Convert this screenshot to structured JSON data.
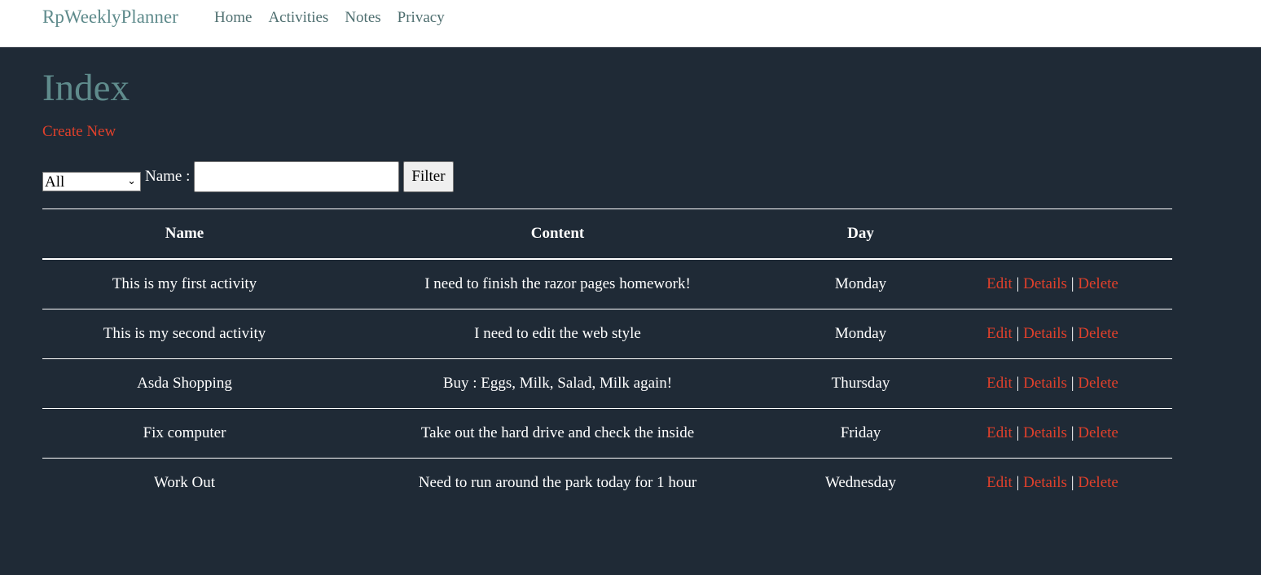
{
  "navbar": {
    "brand": "RpWeeklyPlanner",
    "links": [
      "Home",
      "Activities",
      "Notes",
      "Privacy"
    ]
  },
  "main": {
    "title": "Index",
    "create_label": "Create New"
  },
  "filter": {
    "select_value": "All",
    "name_label": "Name :",
    "name_value": "",
    "button_label": "Filter"
  },
  "table": {
    "headers": [
      "Name",
      "Content",
      "Day",
      ""
    ],
    "actions": [
      "Edit",
      "Details",
      "Delete"
    ],
    "separator": "|",
    "rows": [
      {
        "name": "This is my first activity",
        "content": "I need to finish the razor pages homework!",
        "day": "Monday"
      },
      {
        "name": "This is my second activity",
        "content": "I need to edit the web style",
        "day": "Monday"
      },
      {
        "name": "Asda Shopping",
        "content": "Buy : Eggs, Milk, Salad, Milk again!",
        "day": "Thursday"
      },
      {
        "name": "Fix computer",
        "content": "Take out the hard drive and check the inside",
        "day": "Friday"
      },
      {
        "name": "Work Out",
        "content": "Need to run around the park today for 1 hour",
        "day": "Wednesday"
      }
    ]
  },
  "colors": {
    "background": "#1f2a36",
    "accent": "#5f8b8c",
    "link": "#e0402b"
  }
}
